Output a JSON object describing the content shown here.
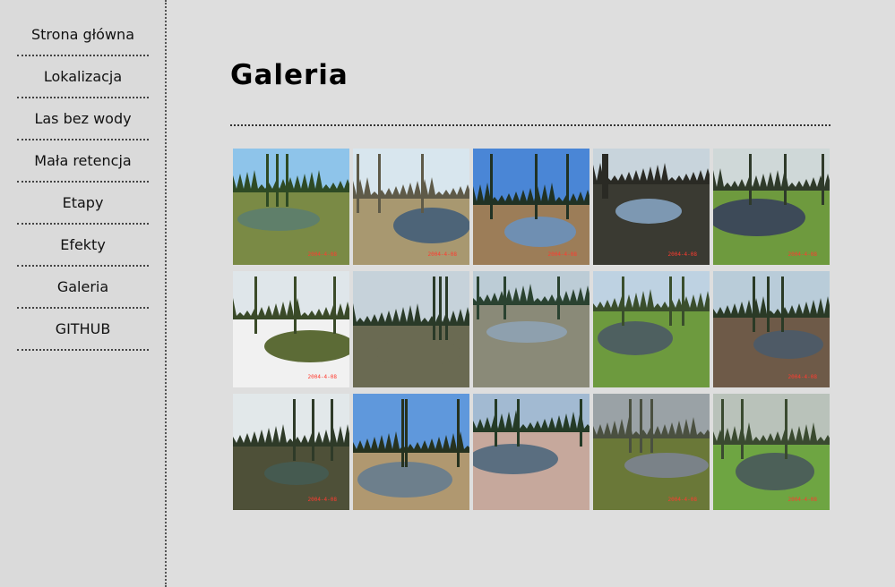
{
  "sidebar": {
    "items": [
      {
        "label": "Strona główna"
      },
      {
        "label": "Lokalizacja"
      },
      {
        "label": "Las bez wody"
      },
      {
        "label": "Mała retencja"
      },
      {
        "label": "Etapy"
      },
      {
        "label": "Efekty"
      },
      {
        "label": "Galeria"
      },
      {
        "label": "GITHUB"
      }
    ]
  },
  "main": {
    "title": "Galeria"
  },
  "gallery": {
    "photos": [
      {
        "subject": "pond in meadow with pines",
        "sky": "#8ec4ea",
        "ground": "#7a8a45",
        "water": "#5f7f6a",
        "trees": "#2e4a24",
        "stamp": "2004-4-08"
      },
      {
        "subject": "stream through dry reeds",
        "sky": "#d8e6ee",
        "ground": "#a89870",
        "water": "#4d6478",
        "trees": "#5e5a48",
        "stamp": "2004-4-08"
      },
      {
        "subject": "lake with reeds and blue sky",
        "sky": "#4a86d6",
        "ground": "#9c7d58",
        "water": "#6f8fb2",
        "trees": "#213224",
        "stamp": "2004-4-08"
      },
      {
        "subject": "flooded forest",
        "sky": "#c8d4dc",
        "ground": "#3a3a32",
        "water": "#7d98b2",
        "trees": "#2a2a24",
        "stamp": "2004-4-08"
      },
      {
        "subject": "concrete canal with grass banks",
        "sky": "#cfd8d8",
        "ground": "#6e9a3e",
        "water": "#3d4a58",
        "trees": "#2f3a2a",
        "stamp": "2004-4-08"
      },
      {
        "subject": "canal with snow banks",
        "sky": "#dfe6ea",
        "ground": "#f1f1f1",
        "water": "#5c6b36",
        "trees": "#3a4a28",
        "stamp": "2004-4-08"
      },
      {
        "subject": "forest with young spruce",
        "sky": "#c6d2da",
        "ground": "#6a6a52",
        "water": "#6a6a52",
        "trees": "#2a3a28",
        "stamp": ""
      },
      {
        "subject": "forest pond with spruce",
        "sky": "#bcccd6",
        "ground": "#8a8a78",
        "water": "#8ea0ae",
        "trees": "#2a4230",
        "stamp": ""
      },
      {
        "subject": "meadow with channel",
        "sky": "#bed2e2",
        "ground": "#6d9a3e",
        "water": "#4e6060",
        "trees": "#3a4e2c",
        "stamp": ""
      },
      {
        "subject": "lake with spruce",
        "sky": "#b9ccd9",
        "ground": "#6e5a48",
        "water": "#4e5a66",
        "trees": "#2a3a26",
        "stamp": "2004-4-08"
      },
      {
        "subject": "forest canal reflection",
        "sky": "#e2e8ea",
        "ground": "#4e5038",
        "water": "#455a50",
        "trees": "#2e3a28",
        "stamp": "2004-4-08"
      },
      {
        "subject": "lake shore with reeds",
        "sky": "#5f98dc",
        "ground": "#b09870",
        "water": "#6d7f8c",
        "trees": "#26321f",
        "stamp": ""
      },
      {
        "subject": "forest lake with reeds",
        "sky": "#a2bad2",
        "ground": "#c6a89c",
        "water": "#5a6e80",
        "trees": "#243a26",
        "stamp": ""
      },
      {
        "subject": "misty pond",
        "sky": "#9aa2a6",
        "ground": "#6a7838",
        "water": "#7a8288",
        "trees": "#4a5040",
        "stamp": "2004-4-08"
      },
      {
        "subject": "concrete weir in meadow",
        "sky": "#b9c2ba",
        "ground": "#6ea542",
        "water": "#4c6058",
        "trees": "#3a4a30",
        "stamp": "2004-4-08"
      }
    ]
  }
}
